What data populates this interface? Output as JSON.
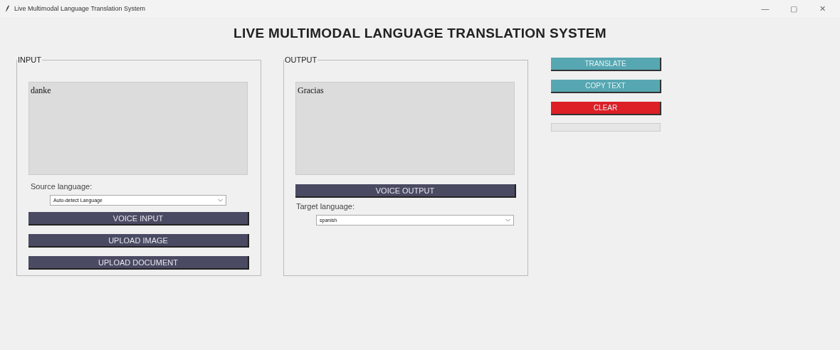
{
  "window": {
    "title": "Live Multimodal Language Translation System",
    "controls": [
      "—",
      "▢",
      "✕"
    ]
  },
  "heading": "LIVE MULTIMODAL LANGUAGE TRANSLATION SYSTEM",
  "input": {
    "label": "INPUT",
    "text": "danke",
    "language_label": "Source language:",
    "language": "Auto-detect Language",
    "buttons": [
      "VOICE INPUT",
      "UPLOAD IMAGE",
      "UPLOAD DOCUMENT"
    ]
  },
  "output": {
    "label": "OUTPUT",
    "text": "Gracias",
    "button": "VOICE OUTPUT",
    "language_label": "Target language:",
    "language": "spanish"
  },
  "actions": [
    {
      "label": "TRANSLATE",
      "kind": "primary"
    },
    {
      "label": "COPY TEXT",
      "kind": "primary"
    },
    {
      "label": "CLEAR",
      "kind": "danger"
    }
  ],
  "progress": {
    "level": 0
  }
}
